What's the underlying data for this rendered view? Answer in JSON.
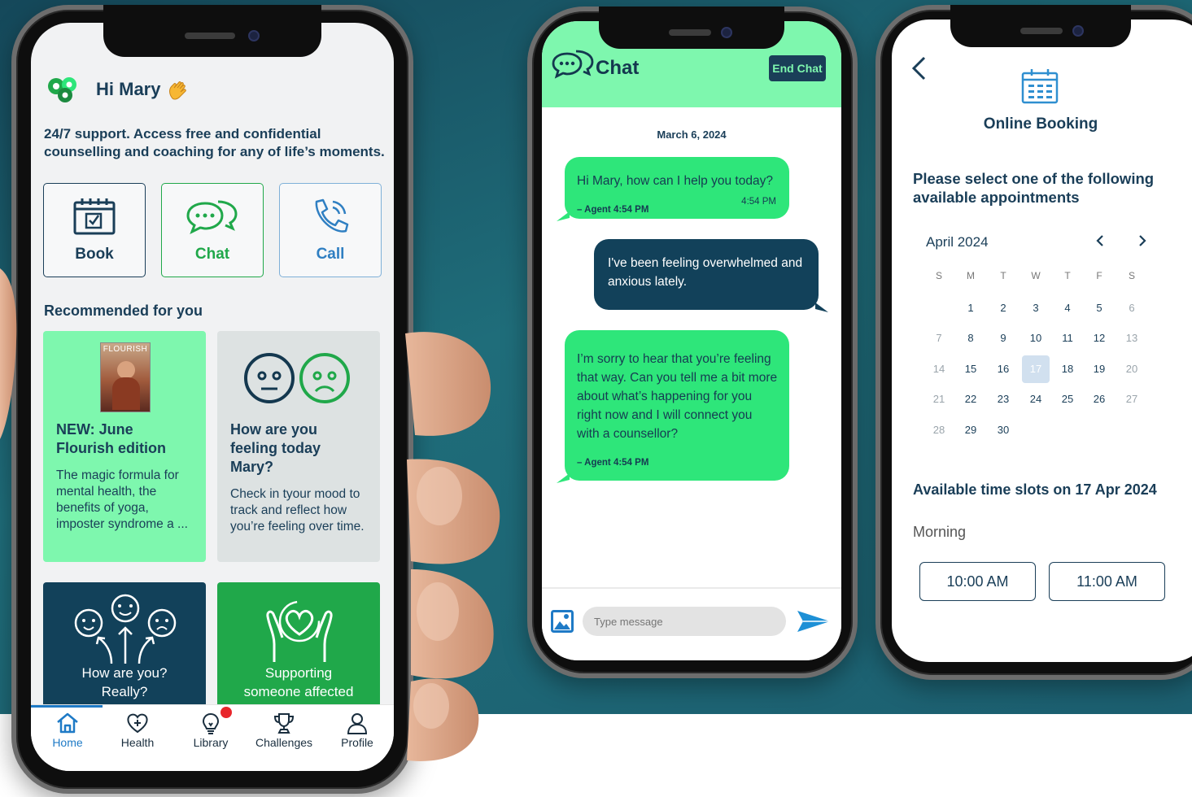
{
  "colors": {
    "navy": "#1a3e58",
    "mint": "#7ef7ae",
    "chat_green": "#2ee67a",
    "dark_teal": "#12415a",
    "brand_green": "#20a84a",
    "accent_blue": "#1e7ac6",
    "notification_red": "#e8262b"
  },
  "home": {
    "greeting": "Hi Mary",
    "intro": "24/7 support. Access free and confidential counselling and coaching for any of life’s moments.",
    "actions": [
      {
        "label": "Book",
        "icon": "calendar-icon"
      },
      {
        "label": "Chat",
        "icon": "chat-bubbles-icon"
      },
      {
        "label": "Call",
        "icon": "phone-icon"
      }
    ],
    "recommended_title": "Recommended for you",
    "cards": [
      {
        "title": "NEW: June Flourish edition",
        "body": "The magic formula for mental health, the benefits of yoga, imposter syndrome a ...",
        "magazine_masthead": "FLOURISH"
      },
      {
        "title": "How are you feeling today Mary?",
        "body": "Check in tyour mood to track and reflect how you’re feeling over time."
      },
      {
        "title": "How are you? Really?"
      },
      {
        "title": "Supporting someone affected"
      }
    ],
    "tabs": [
      {
        "label": "Home",
        "icon": "home-icon",
        "active": true
      },
      {
        "label": "Health",
        "icon": "heart-plus-icon"
      },
      {
        "label": "Library",
        "icon": "lightbulb-icon",
        "badge": true
      },
      {
        "label": "Challenges",
        "icon": "trophy-icon"
      },
      {
        "label": "Profile",
        "icon": "person-icon"
      }
    ]
  },
  "chat": {
    "title": "Chat",
    "end_chat": "End Chat",
    "date": "March 6, 2024",
    "messages": [
      {
        "from": "agent",
        "text": "Hi Mary, how can I help you today?",
        "time": "4:54 PM",
        "meta": "– Agent 4:54 PM"
      },
      {
        "from": "user",
        "text": "I've been feeling overwhelmed and anxious lately."
      },
      {
        "from": "agent",
        "text": "I’m sorry to hear that you’re feeling that way. Can you tell me a bit more about what’s happening for you right now and I will connect you with a counsellor?",
        "meta": "– Agent 4:54 PM"
      }
    ],
    "input_placeholder": "Type message"
  },
  "booking": {
    "title": "Online Booking",
    "prompt": "Please select one of the following available appointments",
    "month": "April 2024",
    "weekdays": [
      "S",
      "M",
      "T",
      "W",
      "T",
      "F",
      "S"
    ],
    "first_weekday": 1,
    "days_in_month": 30,
    "selected_day": 17,
    "slots_title": "Available time slots on 17 Apr 2024",
    "period": "Morning",
    "slots": [
      "10:00 AM",
      "11:00 AM"
    ]
  }
}
